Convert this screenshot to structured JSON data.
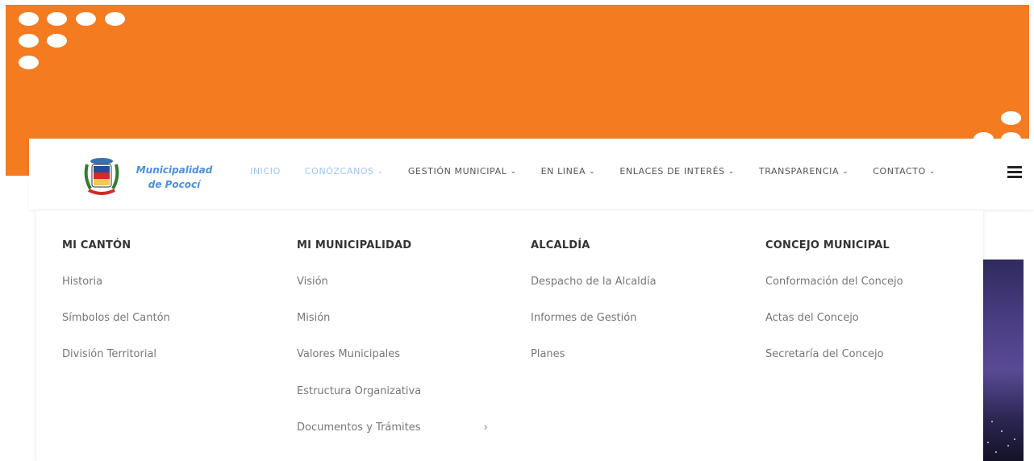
{
  "colors": {
    "banner": "#F47B20",
    "nav_active": "#9ec5ef",
    "nav_text": "#555555",
    "heading": "#333333",
    "link": "#777777",
    "logo_text": "#4a90e2"
  },
  "logo": {
    "line1": "Municipalidad",
    "line2": "de Pococí",
    "icon": "coat-of-arms-icon"
  },
  "nav": {
    "items": [
      {
        "label": "INICIO",
        "dropdown": false,
        "active": true
      },
      {
        "label": "CONÓZCANOS",
        "dropdown": true,
        "active": true
      },
      {
        "label": "GESTIÓN MUNICIPAL",
        "dropdown": true,
        "active": false
      },
      {
        "label": "EN LINEA",
        "dropdown": true,
        "active": false
      },
      {
        "label": "ENLACES DE INTERÉS",
        "dropdown": true,
        "active": false
      },
      {
        "label": "TRANSPARENCIA",
        "dropdown": true,
        "active": false
      },
      {
        "label": "CONTACTO",
        "dropdown": true,
        "active": false
      }
    ],
    "dropdown_icon": "chevron-down-icon",
    "menu_icon": "hamburger-icon"
  },
  "mega_menu": {
    "columns": [
      {
        "heading": "MI CANTÓN",
        "links": [
          "Historia",
          "Símbolos del Cantón",
          "División Territorial"
        ]
      },
      {
        "heading": "MI MUNICIPALIDAD",
        "links": [
          "Visión",
          "Misión",
          "Valores Municipales",
          "Estructura Organizativa",
          "Documentos y Trámites"
        ],
        "submenu_arrow": "›"
      },
      {
        "heading": "ALCALDÍA",
        "links": [
          "Despacho de la Alcaldía",
          "Informes de Gestión",
          "Planes"
        ]
      },
      {
        "heading": "CONCEJO MUNICIPAL",
        "links": [
          "Conformación del Concejo",
          "Actas del Concejo",
          "Secretaría del Concejo"
        ]
      }
    ]
  }
}
